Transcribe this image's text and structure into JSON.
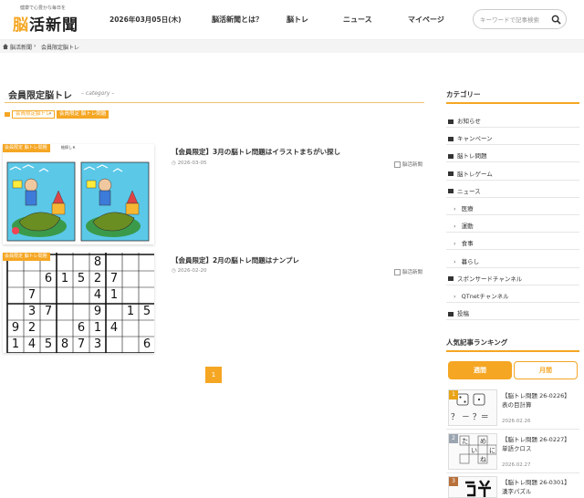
{
  "header": {
    "tagline": "健康で心豊かな毎日を",
    "logo_a": "脳",
    "logo_b": "活新聞",
    "date": "2026年03月05日(木)",
    "nav": [
      "脳活新聞とは？",
      "脳トレ",
      "ニュース",
      "マイページ"
    ],
    "search_placeholder": "キーワードで記事検索"
  },
  "breadcrumb": {
    "home": "脳活新聞",
    "sep": "›",
    "current": "会員限定脳トレ"
  },
  "main": {
    "title": "会員限定脳トレ",
    "subtitle": "– category –",
    "tags": [
      "会員限定脳トレ",
      "会員限定 脳トレ問題"
    ],
    "tag_sep": "›",
    "posts": [
      {
        "category": "会員限定 脳トレ問題",
        "thumb_caption": "絵探しＫ",
        "title": "【会員限定】3月の脳トレ問題はイラストまちがい探し",
        "date": "2026-03-05",
        "author": "脳活新聞"
      },
      {
        "category": "会員限定 脳トレ問題",
        "title": "【会員限定】2月の脳トレ問題はナンプレ",
        "date": "2026-02-20",
        "author": "脳活新聞"
      }
    ],
    "sudoku_digits": [
      {
        "r": 0,
        "c": 5,
        "v": "8"
      },
      {
        "r": 1,
        "c": 2,
        "v": "6"
      },
      {
        "r": 1,
        "c": 3,
        "v": "1"
      },
      {
        "r": 1,
        "c": 4,
        "v": "5"
      },
      {
        "r": 1,
        "c": 5,
        "v": "2"
      },
      {
        "r": 1,
        "c": 6,
        "v": "7"
      },
      {
        "r": 2,
        "c": 1,
        "v": "7"
      },
      {
        "r": 2,
        "c": 5,
        "v": "4"
      },
      {
        "r": 2,
        "c": 6,
        "v": "1"
      },
      {
        "r": 3,
        "c": 1,
        "v": "3"
      },
      {
        "r": 3,
        "c": 2,
        "v": "7"
      },
      {
        "r": 3,
        "c": 5,
        "v": "9"
      },
      {
        "r": 3,
        "c": 7,
        "v": "1"
      },
      {
        "r": 3,
        "c": 8,
        "v": "5"
      },
      {
        "r": 4,
        "c": 0,
        "v": "9"
      },
      {
        "r": 4,
        "c": 1,
        "v": "2"
      },
      {
        "r": 4,
        "c": 4,
        "v": "6"
      },
      {
        "r": 4,
        "c": 5,
        "v": "1"
      },
      {
        "r": 4,
        "c": 6,
        "v": "4"
      },
      {
        "r": 5,
        "c": 0,
        "v": "1"
      },
      {
        "r": 5,
        "c": 1,
        "v": "4"
      },
      {
        "r": 5,
        "c": 2,
        "v": "5"
      },
      {
        "r": 5,
        "c": 3,
        "v": "8"
      },
      {
        "r": 5,
        "c": 4,
        "v": "7"
      },
      {
        "r": 5,
        "c": 5,
        "v": "3"
      },
      {
        "r": 5,
        "c": 8,
        "v": "6"
      }
    ],
    "page_number": "1"
  },
  "sidebar": {
    "category_heading": "カテゴリー",
    "categories": [
      {
        "label": "お知らせ",
        "sub": false
      },
      {
        "label": "キャンペーン",
        "sub": false
      },
      {
        "label": "脳トレ問題",
        "sub": false
      },
      {
        "label": "脳トレゲーム",
        "sub": false
      },
      {
        "label": "ニュース",
        "sub": false
      },
      {
        "label": "医療",
        "sub": true
      },
      {
        "label": "運動",
        "sub": true
      },
      {
        "label": "食事",
        "sub": true
      },
      {
        "label": "暮らし",
        "sub": true
      },
      {
        "label": "スポンサードチャンネル",
        "sub": false
      },
      {
        "label": "QTnetチャンネル",
        "sub": true
      },
      {
        "label": "投稿",
        "sub": false
      }
    ],
    "ranking_heading": "人気記事ランキング",
    "tabs": [
      "週間",
      "月間"
    ],
    "ranking": [
      {
        "num": "1",
        "title1": "【脳トレ問題 26-0226】",
        "title2": "表の目計算",
        "date": "2026.02.26",
        "color": "#e8a317"
      },
      {
        "num": "2",
        "title1": "【脳トレ問題 26-0227】",
        "title2": "単語クロス",
        "date": "2026.02.27",
        "color": "#9aa5b1"
      },
      {
        "num": "3",
        "title1": "【脳トレ問題 26-0301】",
        "title2": "漢字パズル",
        "date": "",
        "color": "#b8703a"
      }
    ],
    "dice_formula": "？ － ？＝",
    "cross_chars": [
      "た",
      "め",
      "い",
      "に",
      "ね"
    ]
  },
  "colors": {
    "accent": "#f5a623"
  }
}
